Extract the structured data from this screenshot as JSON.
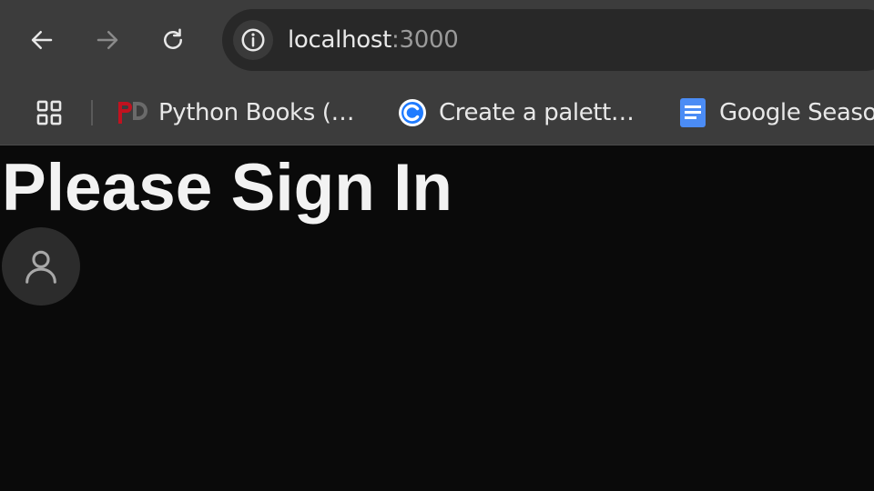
{
  "browser": {
    "url_host": "localhost",
    "url_port": ":3000",
    "bookmarks": [
      {
        "label": "Python Books (…",
        "icon": "pd-logo-icon"
      },
      {
        "label": "Create a palett…",
        "icon": "coolors-icon"
      },
      {
        "label": "Google Seaso",
        "icon": "google-docs-icon"
      }
    ]
  },
  "page": {
    "title": "Please Sign In"
  },
  "colors": {
    "chrome": "#3c3c3c",
    "omnibox": "#282828",
    "page_bg": "#0a0a0a",
    "title": "#f2f2f2",
    "avatar_bg": "#2c2c2c"
  }
}
